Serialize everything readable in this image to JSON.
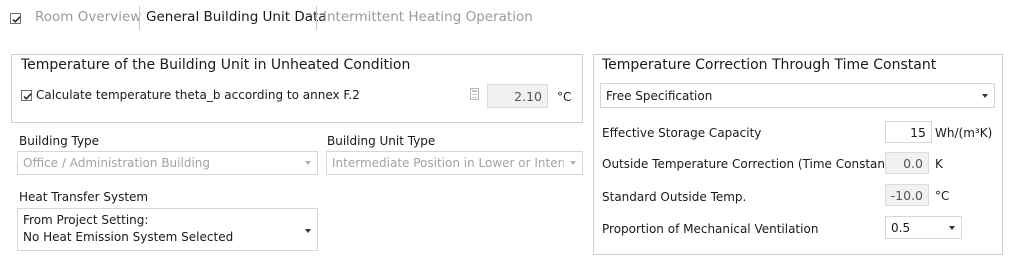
{
  "tabs": {
    "items": [
      {
        "label": "Room Overview"
      },
      {
        "label": "General Building Unit Data"
      },
      {
        "label": "Intermittent Heating Operation"
      }
    ]
  },
  "unheated": {
    "title": "Temperature of the Building Unit in Unheated Condition",
    "checkbox_label": "Calculate temperature theta_b according to annex F.2",
    "checked": true,
    "value": "2.10",
    "unit": "°C"
  },
  "building_type": {
    "label": "Building Type",
    "value": "Office / Administration Building"
  },
  "building_unit_type": {
    "label": "Building Unit Type",
    "value": "Intermediate Position in Lower or Interm"
  },
  "heat_transfer": {
    "label": "Heat Transfer System",
    "line1": "From Project Setting:",
    "line2": "No Heat Emission System Selected"
  },
  "time_constant": {
    "title": "Temperature Correction Through Time Constant",
    "mode_value": "Free Specification",
    "storage": {
      "label": "Effective Storage Capacity",
      "value": "15",
      "unit": "Wh/(m³K)"
    },
    "outside_corr": {
      "label": "Outside Temperature Correction (Time Constant)",
      "value": "0.0",
      "unit": "K"
    },
    "std_outside": {
      "label": "Standard Outside Temp.",
      "value": "-10.0",
      "unit": "°C"
    },
    "mech_vent": {
      "label": "Proportion of Mechanical Ventilation",
      "value": "0.5"
    }
  }
}
